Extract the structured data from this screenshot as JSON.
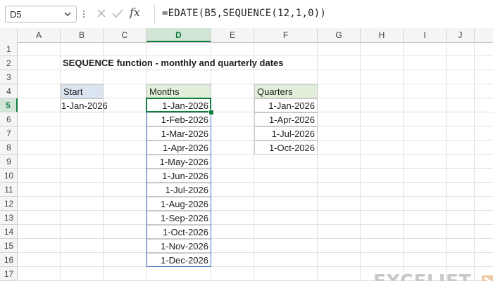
{
  "name_box": {
    "value": "D5"
  },
  "formula_bar": {
    "fx": "fx",
    "formula": "=EDATE(B5,SEQUENCE(12,1,0))"
  },
  "columns": [
    "A",
    "B",
    "C",
    "D",
    "E",
    "F",
    "G",
    "H",
    "I",
    "J"
  ],
  "rows": [
    "1",
    "2",
    "3",
    "4",
    "5",
    "6",
    "7",
    "8",
    "9",
    "10",
    "11",
    "12",
    "13",
    "14",
    "15",
    "16",
    "17"
  ],
  "active_cell": {
    "column": "D",
    "row": "5"
  },
  "sheet": {
    "title": "SEQUENCE function - monthly and quarterly dates",
    "start": {
      "header": "Start",
      "value": "1-Jan-2026"
    },
    "months": {
      "header": "Months",
      "values": [
        "1-Jan-2026",
        "1-Feb-2026",
        "1-Mar-2026",
        "1-Apr-2026",
        "1-May-2026",
        "1-Jun-2026",
        "1-Jul-2026",
        "1-Aug-2026",
        "1-Sep-2026",
        "1-Oct-2026",
        "1-Nov-2026",
        "1-Dec-2026"
      ]
    },
    "quarters": {
      "header": "Quarters",
      "values": [
        "1-Jan-2026",
        "1-Apr-2026",
        "1-Jul-2026",
        "1-Oct-2026"
      ]
    }
  },
  "logo": {
    "text": "EXCELJET"
  },
  "colors": {
    "accent_green": "#107c41",
    "header_blue": "#dbe5f1",
    "header_green": "#e2efda",
    "spill_blue": "#4472c4"
  }
}
